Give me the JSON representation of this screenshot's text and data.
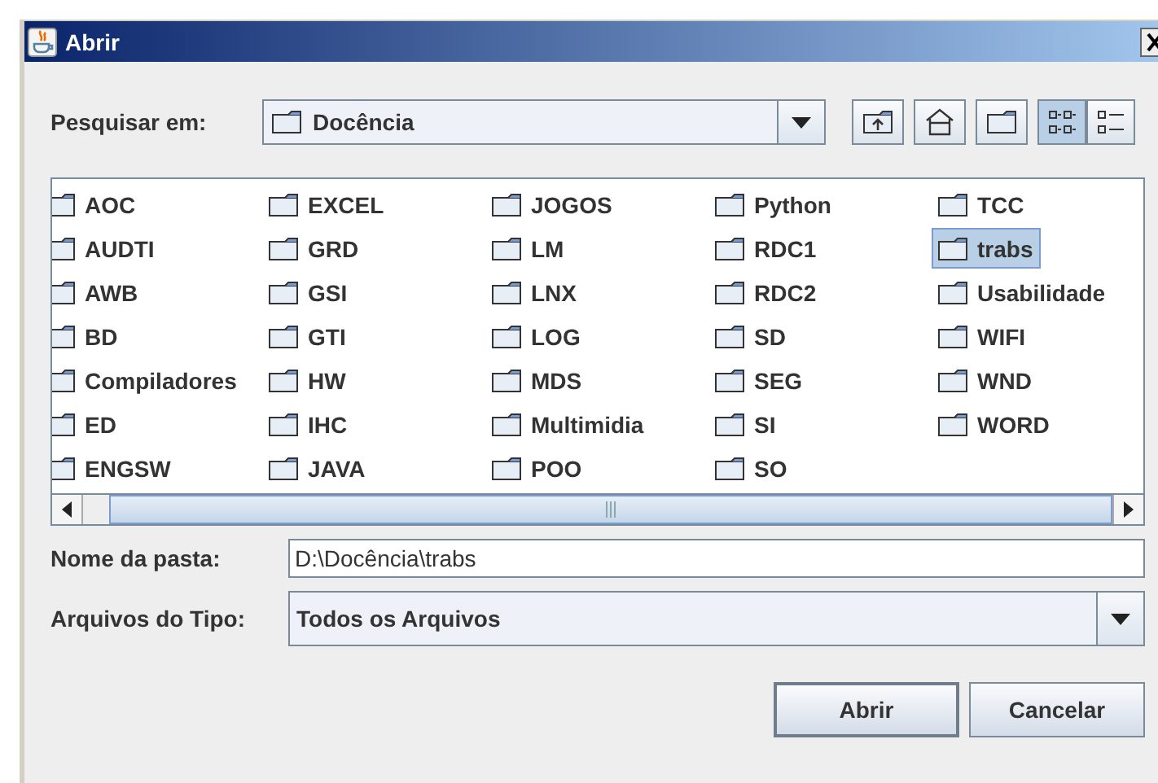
{
  "window": {
    "title": "Abrir"
  },
  "look_in": {
    "label": "Pesquisar em:",
    "value": "Docência"
  },
  "toolbar": {
    "views": [
      {
        "kind": "list",
        "selected": true
      },
      {
        "kind": "details",
        "selected": false
      }
    ]
  },
  "folders": [
    [
      {
        "name": "AOC",
        "selected": false
      },
      {
        "name": "AUDTI",
        "selected": false
      },
      {
        "name": "AWB",
        "selected": false
      },
      {
        "name": "BD",
        "selected": false
      },
      {
        "name": "Compiladores",
        "selected": false
      },
      {
        "name": "ED",
        "selected": false
      },
      {
        "name": "ENGSW",
        "selected": false
      }
    ],
    [
      {
        "name": "EXCEL",
        "selected": false
      },
      {
        "name": "GRD",
        "selected": false
      },
      {
        "name": "GSI",
        "selected": false
      },
      {
        "name": "GTI",
        "selected": false
      },
      {
        "name": "HW",
        "selected": false
      },
      {
        "name": "IHC",
        "selected": false
      },
      {
        "name": "JAVA",
        "selected": false
      }
    ],
    [
      {
        "name": "JOGOS",
        "selected": false
      },
      {
        "name": "LM",
        "selected": false
      },
      {
        "name": "LNX",
        "selected": false
      },
      {
        "name": "LOG",
        "selected": false
      },
      {
        "name": "MDS",
        "selected": false
      },
      {
        "name": "Multimidia",
        "selected": false
      },
      {
        "name": "POO",
        "selected": false
      }
    ],
    [
      {
        "name": "Python",
        "selected": false
      },
      {
        "name": "RDC1",
        "selected": false
      },
      {
        "name": "RDC2",
        "selected": false
      },
      {
        "name": "SD",
        "selected": false
      },
      {
        "name": "SEG",
        "selected": false
      },
      {
        "name": "SI",
        "selected": false
      },
      {
        "name": "SO",
        "selected": false
      }
    ],
    [
      {
        "name": "TCC",
        "selected": false
      },
      {
        "name": "trabs",
        "selected": true
      },
      {
        "name": "Usabilidade",
        "selected": false
      },
      {
        "name": "WIFI",
        "selected": false
      },
      {
        "name": "WND",
        "selected": false
      },
      {
        "name": "WORD",
        "selected": false
      }
    ]
  ],
  "folder_name": {
    "label": "Nome da pasta:",
    "value": "D:\\Docência\\trabs"
  },
  "file_type": {
    "label": "Arquivos do Tipo:",
    "value": "Todos os Arquivos"
  },
  "buttons": [
    "Abrir",
    "Cancelar"
  ]
}
